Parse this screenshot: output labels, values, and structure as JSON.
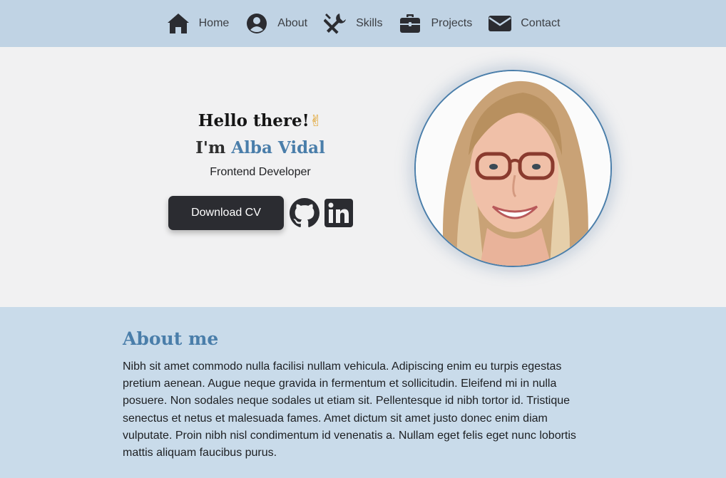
{
  "nav": {
    "items": [
      {
        "label": "Home",
        "icon": "home-icon"
      },
      {
        "label": "About",
        "icon": "user-circle-icon"
      },
      {
        "label": "Skills",
        "icon": "tools-icon"
      },
      {
        "label": "Projects",
        "icon": "briefcase-icon"
      },
      {
        "label": "Contact",
        "icon": "envelope-icon"
      }
    ]
  },
  "hero": {
    "greeting": "Hello there!",
    "greeting_emoji": "✌",
    "intro_prefix": "I'm ",
    "name": "Alba Vidal",
    "role": "Frontend Developer",
    "cv_button": "Download CV",
    "social": [
      "github-icon",
      "linkedin-icon"
    ],
    "portrait": "profile-photo"
  },
  "about": {
    "title": "About me",
    "text": "Nibh sit amet commodo nulla facilisi nullam vehicula. Adipiscing enim eu turpis egestas pretium aenean. Augue neque gravida in fermentum et sollicitudin. Eleifend mi in nulla posuere. Non sodales neque sodales ut etiam sit. Pellentesque id nibh tortor id. Tristique senectus et netus et malesuada fames. Amet dictum sit amet justo donec enim diam vulputate. Proin nibh nisl condimentum id venenatis a. Nullam eget felis eget nunc lobortis mattis aliquam faucibus purus."
  },
  "colors": {
    "nav_bg": "#c0d3e4",
    "hero_bg": "#f1f1f2",
    "section_bg": "#c9dbea",
    "accent": "#4a7eaa",
    "button_bg": "#2b2c31"
  }
}
